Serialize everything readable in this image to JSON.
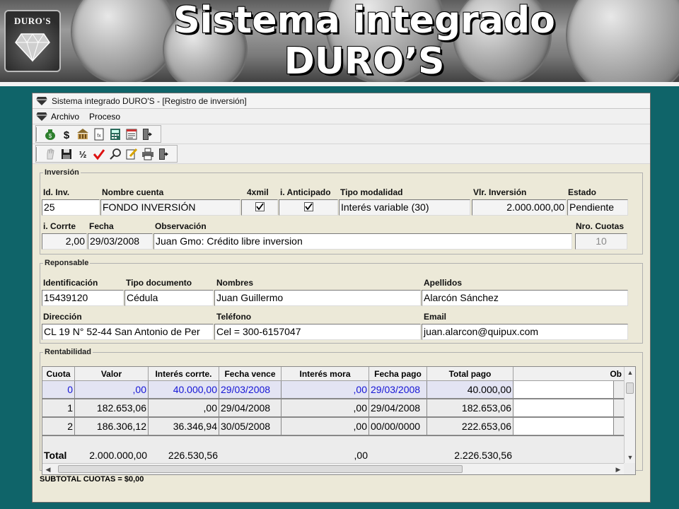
{
  "slide": {
    "title_line1": "Sistema integrado",
    "title_line2": "DURO’S",
    "logo_text": "DURO'S"
  },
  "window": {
    "title": "Sistema integrado DURO'S - [Registro de inversión]"
  },
  "menu": [
    {
      "label": "Archivo"
    },
    {
      "label": "Proceso"
    }
  ],
  "toolbar1": [
    "money-bag-icon",
    "dollar-icon",
    "bank-icon",
    "document-fx-icon",
    "calculator-icon",
    "report-icon",
    "exit-door-icon"
  ],
  "toolbar2": [
    "hand-icon",
    "save-icon",
    "percent-icon",
    "checkmark-icon",
    "search-icon",
    "edit-icon",
    "print-icon",
    "exit-door-icon"
  ],
  "inversion": {
    "legend": "Inversión",
    "labels": {
      "id": "Id. Inv.",
      "nombre": "Nombre cuenta",
      "x4mil": "4xmil",
      "anticipado": "i. Anticipado",
      "modalidad": "Tipo modalidad",
      "valor": "Vlr. Inversión",
      "estado": "Estado",
      "corrte": "i. Corrte",
      "fecha": "Fecha",
      "observacion": "Observación",
      "cuotas": "Nro. Cuotas"
    },
    "values": {
      "id": "25",
      "nombre": "FONDO INVERSIÓN",
      "x4mil": true,
      "anticipado": true,
      "modalidad": "Interés variable (30)",
      "valor": "2.000.000,00",
      "estado": "Pendiente",
      "corrte": "2,00",
      "fecha": "29/03/2008",
      "observacion": "Juan Gmo: Crédito libre inversion",
      "cuotas": "10"
    }
  },
  "responsable": {
    "legend": "Reponsable",
    "labels": {
      "identificacion": "Identificación",
      "tipo_doc": "Tipo documento",
      "nombres": "Nombres",
      "apellidos": "Apellidos",
      "direccion": "Dirección",
      "telefono": "Teléfono",
      "email": "Email"
    },
    "values": {
      "identificacion": "15439120",
      "tipo_doc": "Cédula",
      "nombres": "Juan Guillermo",
      "apellidos": "Alarcón Sánchez",
      "direccion": "CL 19 N° 52-44 San Antonio de Per",
      "telefono": "Cel = 300-6157047",
      "email": "juan.alarcon@quipux.com"
    }
  },
  "rentabilidad": {
    "legend": "Rentabilidad",
    "columns": [
      "Cuota",
      "Valor",
      "Interés corrte.",
      "Fecha vence",
      "Interés mora",
      "Fecha pago",
      "Total pago",
      "Ob"
    ],
    "rows": [
      {
        "cuota": "0",
        "valor": ",00",
        "interes": "40.000,00",
        "vence": "29/03/2008",
        "mora": ",00",
        "pago": "29/03/2008",
        "total": "40.000,00",
        "obs": ""
      },
      {
        "cuota": "1",
        "valor": "182.653,06",
        "interes": ",00",
        "vence": "29/04/2008",
        "mora": ",00",
        "pago": "29/04/2008",
        "total": "182.653,06",
        "obs": ""
      },
      {
        "cuota": "2",
        "valor": "186.306,12",
        "interes": "36.346,94",
        "vence": "30/05/2008",
        "mora": ",00",
        "pago": "00/00/0000",
        "total": "222.653,06",
        "obs": ""
      }
    ],
    "totals": {
      "label": "Total",
      "valor": "2.000.000,00",
      "interes": "226.530,56",
      "mora": ",00",
      "total": "2.226.530,56"
    }
  },
  "subtotal": "SUBTOTAL CUOTAS = $0,00"
}
